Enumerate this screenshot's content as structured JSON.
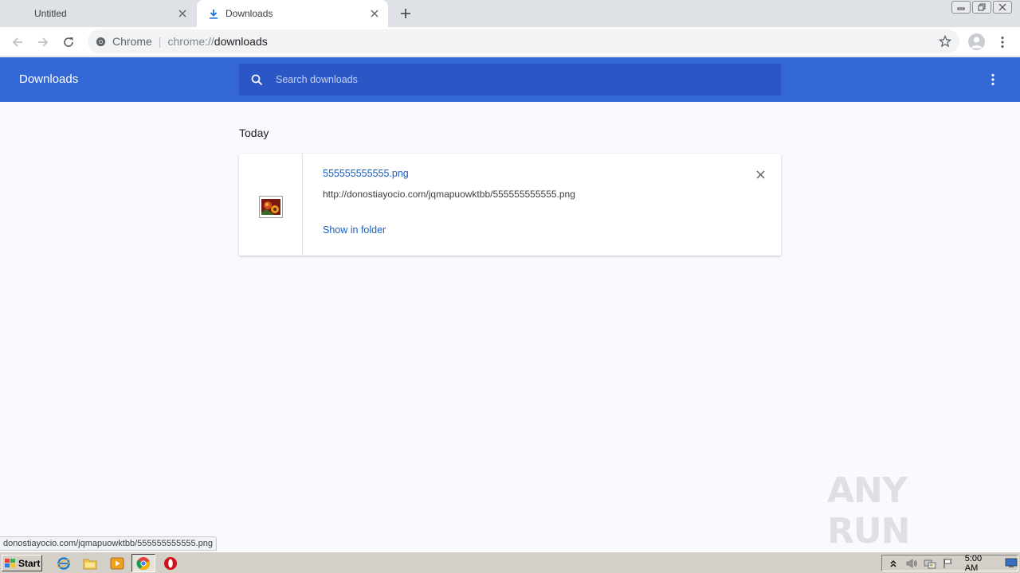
{
  "browser": {
    "tabs": [
      {
        "label": "Untitled",
        "active": false
      },
      {
        "label": "Downloads",
        "active": true,
        "icon": "download-icon"
      }
    ],
    "omnibox": {
      "site_label": "Chrome",
      "separator": "|",
      "url_scheme": "chrome://",
      "url_path": "downloads"
    }
  },
  "downloads_page": {
    "title": "Downloads",
    "search_placeholder": "Search downloads",
    "sections": [
      {
        "date_label": "Today",
        "items": [
          {
            "file_name": "555555555555.png",
            "url": "http://donostiayocio.com/jqmapuowktbb/555555555555.png",
            "action_label": "Show in folder",
            "icon": "image-file-icon"
          }
        ]
      }
    ]
  },
  "status_bar": {
    "text": "donostiayocio.com/jqmapuowktbb/555555555555.png"
  },
  "watermark": {
    "text": "ANY RUN"
  },
  "taskbar": {
    "start_label": "Start",
    "clock": "5:00 AM"
  },
  "colors": {
    "header_blue": "#3367d6",
    "search_blue": "#2a56c6",
    "link_blue": "#1a5ebf",
    "page_bg": "#f8fafd"
  }
}
